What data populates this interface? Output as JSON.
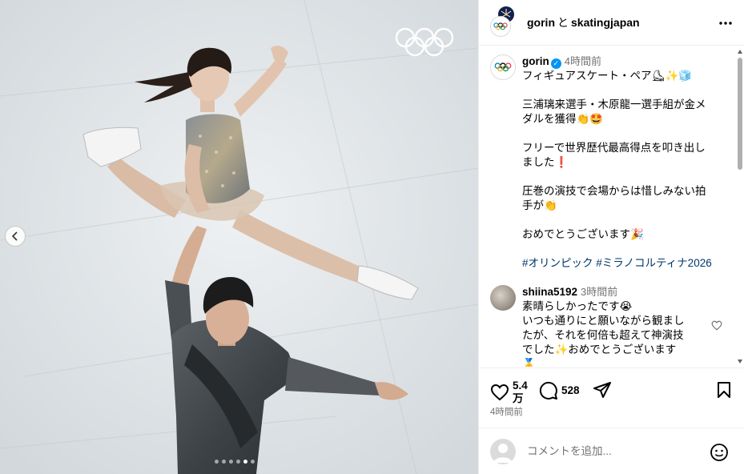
{
  "header": {
    "user_primary": "gorin",
    "connector": "と",
    "user_secondary": "skatingjapan",
    "more_icon": "more-horizontal-icon"
  },
  "media": {
    "watermark": "olympic-rings-logo",
    "prev_icon": "chevron-left-icon",
    "dots_count": 6,
    "active_dot": 5
  },
  "caption": {
    "username": "gorin",
    "verified": true,
    "time": "4時間前",
    "lines": [
      "フィギュアスケート・ペア⛸✨🧊",
      "",
      "三浦璃来選手・木原龍一選手組が金メ",
      "ダルを獲得👏🤩",
      "",
      "フリーで世界歴代最高得点を叩き出し",
      "ました❗",
      "",
      "圧巻の演技で会場からは惜しみない拍",
      "手が👏",
      "",
      "おめでとうございます🎉"
    ],
    "hashtags": "#オリンピック #ミラノコルティナ2026"
  },
  "comment": {
    "username": "shiina5192",
    "time": "3時間前",
    "lines": [
      "素晴らしかったです😭",
      "いつも通りにと願いながら観まし",
      "たが、それを何倍も超えて神演技",
      "でした✨おめでとうございます",
      "🥇"
    ]
  },
  "actions": {
    "like_count_line1": "5.4",
    "like_count_line2": "万",
    "comment_count": "528",
    "posted_time": "4時間前"
  },
  "add_comment": {
    "placeholder": "コメントを追加..."
  },
  "colors": {
    "link": "#00376b",
    "verified": "#0095f6",
    "muted": "#737373"
  }
}
